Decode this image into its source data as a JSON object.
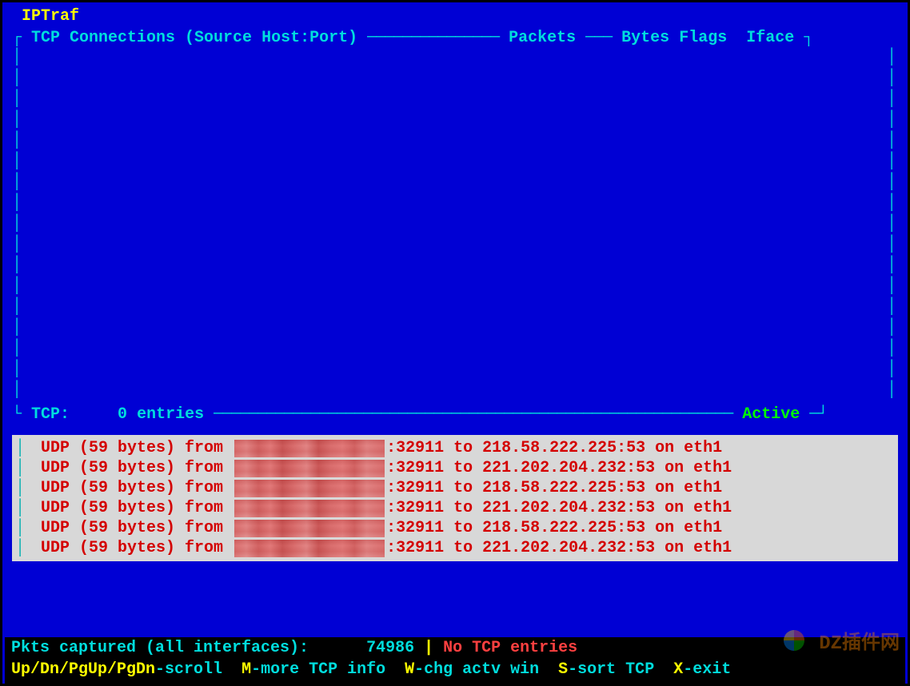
{
  "app_title": "IPTraf",
  "tcp_header": {
    "label": " TCP Connections (Source Host:Port) ",
    "col_packets": " Packets ",
    "col_bytes": " Bytes ",
    "col_flags": "Flags  ",
    "col_iface": "Iface "
  },
  "tcp_footer": {
    "label": " TCP:     ",
    "count": "0",
    "entries_text": " entries ",
    "active": " Active "
  },
  "udp_entries": [
    {
      "prefix": " UDP (59 bytes) from ",
      "suffix": ":32911 to 218.58.222.225:53 on eth1"
    },
    {
      "prefix": " UDP (59 bytes) from ",
      "suffix": ":32911 to 221.202.204.232:53 on eth1"
    },
    {
      "prefix": " UDP (59 bytes) from ",
      "suffix": ":32911 to 218.58.222.225:53 on eth1"
    },
    {
      "prefix": " UDP (59 bytes) from ",
      "suffix": ":32911 to 221.202.204.232:53 on eth1"
    },
    {
      "prefix": " UDP (59 bytes) from ",
      "suffix": ":32911 to 218.58.222.225:53 on eth1"
    },
    {
      "prefix": " UDP (59 bytes) from ",
      "suffix": ":32911 to 221.202.204.232:53 on eth1"
    }
  ],
  "status": {
    "captured_label": "Pkts captured (all interfaces):",
    "captured_count": "74986",
    "separator": " | ",
    "no_tcp": "No TCP entries"
  },
  "hotkeys": {
    "scroll_keys": "Up/Dn/PgUp/PgDn",
    "scroll_label": "-scroll  ",
    "more_key": "M",
    "more_label": "-more TCP info  ",
    "win_key": "W",
    "win_label": "-chg actv win  ",
    "sort_key": "S",
    "sort_label": "-sort TCP  ",
    "exit_key": "X",
    "exit_label": "-exit"
  },
  "watermark": "DZ插件网"
}
